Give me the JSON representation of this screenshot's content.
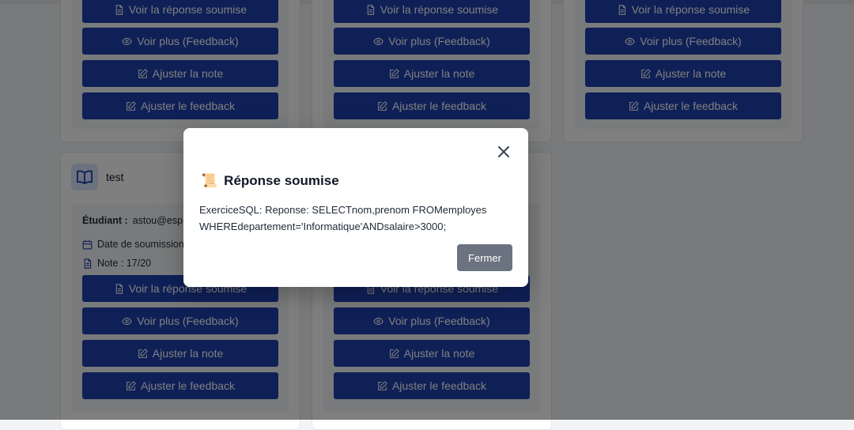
{
  "cards_top": [
    {
      "buttons": [
        "Voir la réponse soumise",
        "Voir plus (Feedback)",
        "Ajuster la note",
        "Ajuster le feedback"
      ]
    },
    {
      "buttons": [
        "Voir la réponse soumise",
        "Voir plus (Feedback)",
        "Ajuster la note",
        "Ajuster le feedback"
      ]
    },
    {
      "buttons": [
        "Voir la réponse soumise",
        "Voir plus (Feedback)",
        "Ajuster la note",
        "Ajuster le feedback"
      ]
    }
  ],
  "card_bottom_left": {
    "title": "test",
    "student_label": "Étudiant :",
    "student_value": "astou@esp.sn",
    "date_label": "Date de soumission :",
    "note": "Note : 17/20",
    "buttons": [
      "Voir la réponse soumise",
      "Voir plus (Feedback)",
      "Ajuster la note",
      "Ajuster le feedback"
    ]
  },
  "card_bottom_middle": {
    "buttons": [
      "Voir la réponse soumise",
      "Voir plus (Feedback)",
      "Ajuster la note",
      "Ajuster le feedback"
    ]
  },
  "modal": {
    "emoji": "📜",
    "title": "Réponse soumise",
    "body_line1": "ExerciceSQL: Reponse: SELECTnom,prenom FROMemployes",
    "body_line2": "WHEREdepartement='Informatique'ANDsalaire>3000;",
    "close_button": "Fermer"
  },
  "colors": {
    "button": "#1e40af",
    "modal_button": "#6b7280",
    "overlay": "rgba(0,0,0,0.5)"
  }
}
